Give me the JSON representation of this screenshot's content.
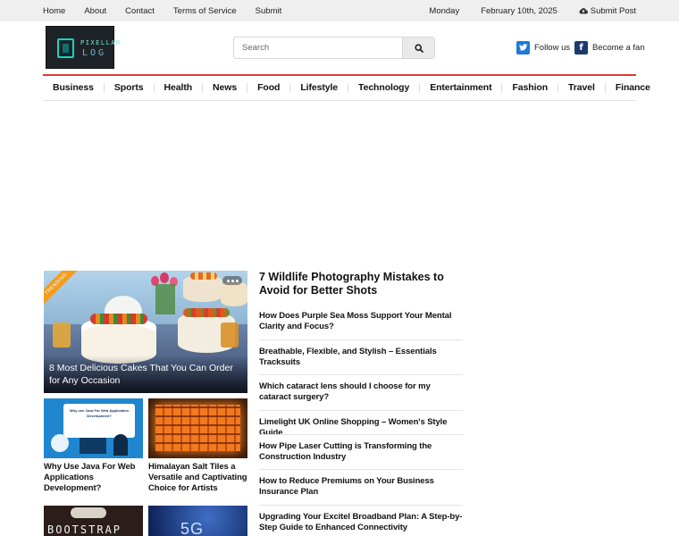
{
  "topbar": {
    "links": [
      "Home",
      "About",
      "Contact",
      "Terms of Service",
      "Submit"
    ],
    "day": "Monday",
    "date": "February 10th, 2025",
    "submit_post": "Submit Post"
  },
  "header": {
    "logo_line1": "PIXELLAR",
    "logo_line2": "LOG",
    "search_placeholder": "Search",
    "follow_label": "Follow us",
    "fan_label": "Become a fan"
  },
  "nav": [
    "Business",
    "Sports",
    "Health",
    "News",
    "Food",
    "Lifestyle",
    "Technology",
    "Entertainment",
    "Fashion",
    "Travel",
    "Finance"
  ],
  "featured": {
    "badge": "TRENDING",
    "title": "8 Most Delicious Cakes That You Can Order for Any Occasion"
  },
  "thumbs": [
    {
      "title": "Why Use Java For Web Applications Development?",
      "img_text": "Why use Java For Web Application Development?"
    },
    {
      "title": "Himalayan Salt Tiles a Versatile and Captivating Choice for Artists"
    },
    {
      "title": "",
      "img_text": "BOOTSTRAP"
    },
    {
      "title": "",
      "img_text": "5G"
    }
  ],
  "lead_title": "7 Wildlife Photography Mistakes to Avoid for Better Shots",
  "list": [
    "How Does Purple Sea Moss Support Your Mental Clarity and Focus?",
    "Breathable, Flexible, and Stylish – Essentials Tracksuits",
    "Which cataract lens should I choose for my cataract surgery?",
    "Limelight UK Online Shopping – Women's Style Guide",
    "How Pipe Laser Cutting is Transforming the Construction Industry",
    "How to Reduce Premiums on Your Business Insurance Plan",
    "Upgrading Your Excitel Broadband Plan: A Step-by-Step Guide to Enhanced Connectivity"
  ],
  "colors": {
    "accent": "#e23b2f",
    "twitter": "#1d7ad6",
    "facebook": "#1c3a6e",
    "badge": "#f39c1f"
  }
}
